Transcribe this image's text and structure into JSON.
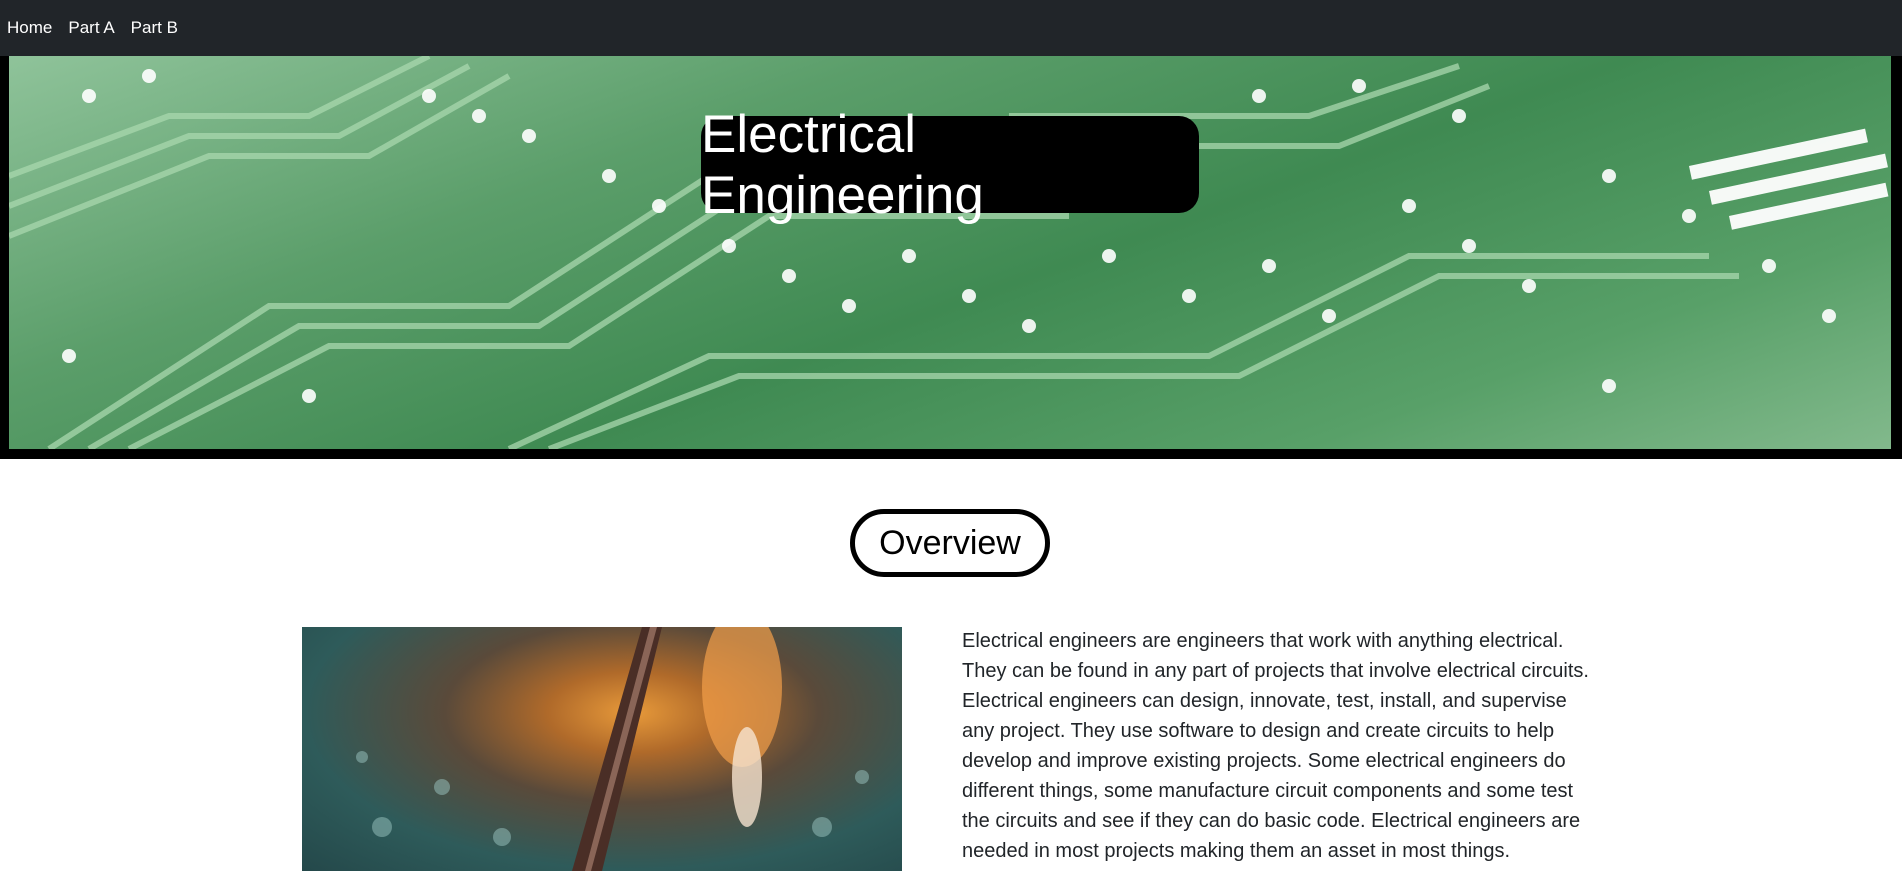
{
  "nav": {
    "items": [
      {
        "label": "Home"
      },
      {
        "label": "Part A"
      },
      {
        "label": "Part B"
      }
    ]
  },
  "hero": {
    "title": "Electrical Engineering",
    "image_icon": "circuit-board-image"
  },
  "overview": {
    "heading": "Overview",
    "image_icon": "soldering-iron-photo",
    "paragraph": "Electrical engineers are engineers that work with anything electrical. They can be found in any part of projects that involve electrical circuits. Electrical engineers can design, innovate, test, install, and supervise any project. They use software to design and create circuits to help develop and improve existing projects. Some electrical engineers do different things, some manufacture circuit components and some test the circuits and see if they can do basic code. Electrical engineers are needed in most projects making them an asset in most things."
  },
  "colors": {
    "navbar_bg": "#212529",
    "hero_border": "#000000",
    "circuit_green": "#3f8a52"
  }
}
